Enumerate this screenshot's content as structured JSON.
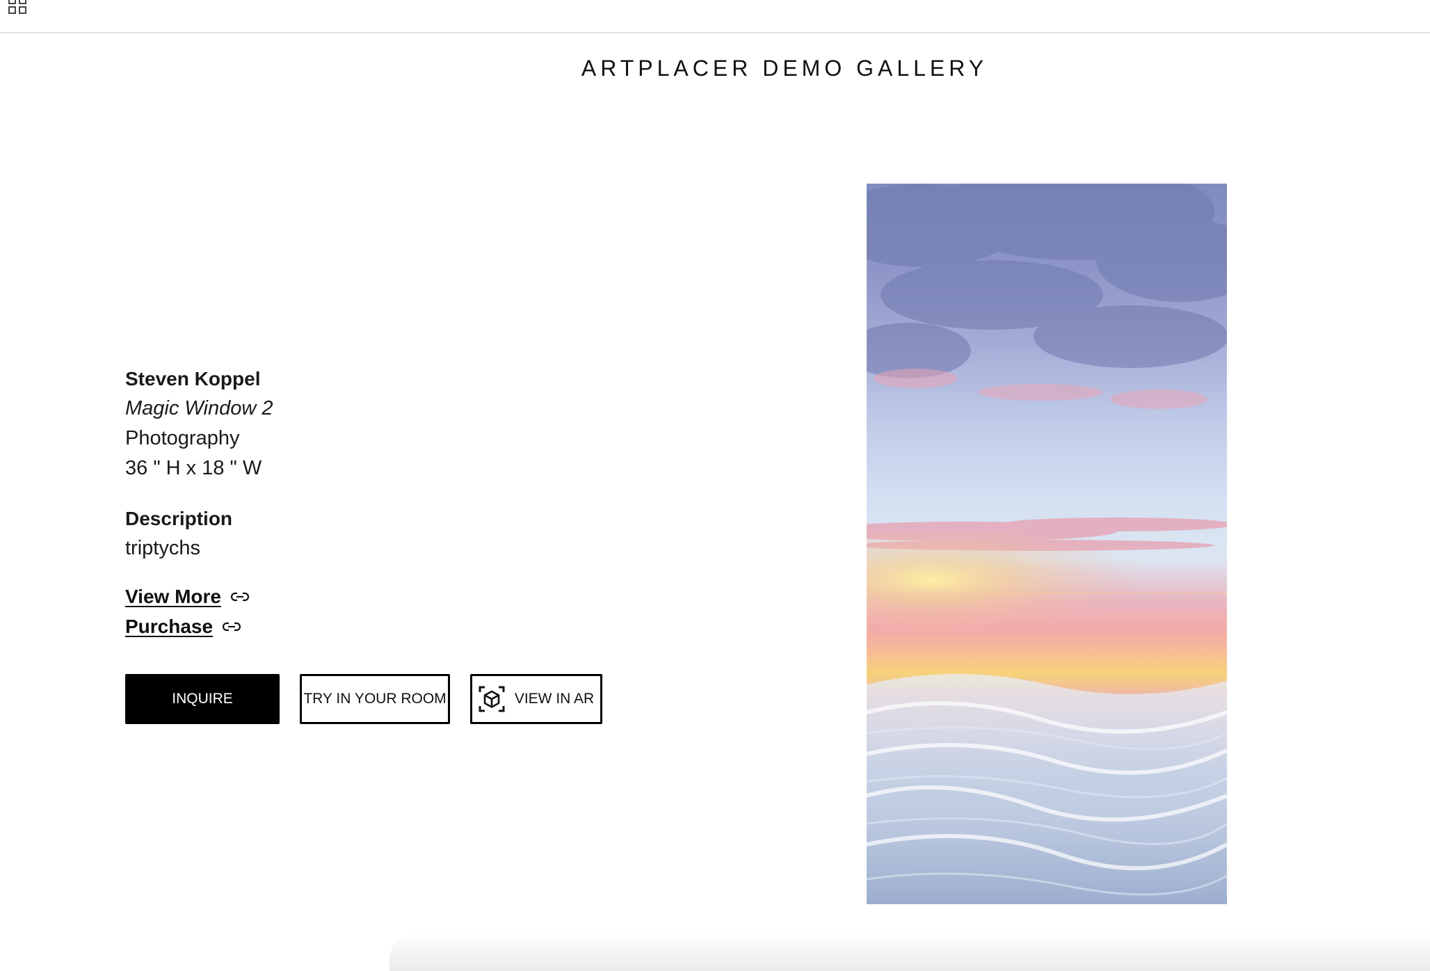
{
  "header": {
    "menu_icon": "grid-icon"
  },
  "gallery": {
    "title": "ARTPLACER DEMO GALLERY"
  },
  "artwork": {
    "artist": "Steven Koppel",
    "title": "Magic Window 2",
    "medium": "Photography",
    "dimensions": "36 \" H x 18 \" W",
    "description_label": "Description",
    "description": "triptychs",
    "image_alt": "seascape-photograph"
  },
  "links": {
    "view_more": "View More",
    "purchase": "Purchase",
    "link_icon": "link-icon"
  },
  "buttons": {
    "inquire": "INQUIRE",
    "try_in_room": "TRY IN YOUR ROOM",
    "view_in_ar": "VIEW IN AR",
    "ar_icon": "ar-cube-icon"
  },
  "colors": {
    "primary_button_bg": "#000000",
    "primary_button_text": "#ffffff",
    "text": "#111111"
  }
}
